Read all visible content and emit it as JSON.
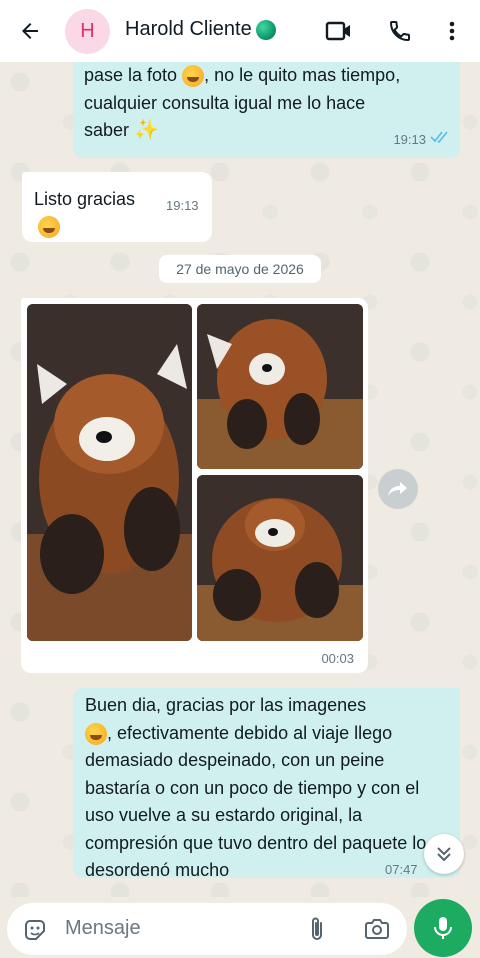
{
  "header": {
    "avatar_initial": "H",
    "contact_name": "Harold Cliente",
    "status_emoji": "green-globe-emoji",
    "icons": [
      "back-arrow-icon",
      "video-call-icon",
      "phone-icon",
      "more-vert-icon"
    ]
  },
  "messages": [
    {
      "direction": "outgoing",
      "text_line1": "pase la foto",
      "text_line1_end": ", no le quito mas tiempo,",
      "text_line2": "cualquier consulta igual me lo hace",
      "text_line3": "saber",
      "time": "19:13",
      "status": "read"
    },
    {
      "direction": "incoming",
      "text": "Listo gracias",
      "time": "19:13"
    },
    {
      "direction": "incoming",
      "type": "media",
      "photos": [
        "red-panda-plush-photo",
        "red-panda-plush-photo",
        "red-panda-plush-photo"
      ],
      "time": "00:03"
    },
    {
      "direction": "outgoing",
      "text_a": "Buen dia, gracias por las imagenes",
      "text_b": ", efectivamente debido al viaje llego demasiado despeinado, con un peine bastaría o con un poco de tiempo y con el uso vuelve a su estardo original, la compresión que tuvo dentro del paquete lo desordenó mucho",
      "time": "07:47",
      "status": "read"
    }
  ],
  "date_separator": "27 de mayo de 2026",
  "composer": {
    "placeholder": "Mensaje"
  },
  "colors": {
    "outgoing_bubble": "#d0f0ef",
    "incoming_bubble": "#ffffff",
    "accent_green": "#1daa61",
    "read_tick": "#53bdeb"
  }
}
